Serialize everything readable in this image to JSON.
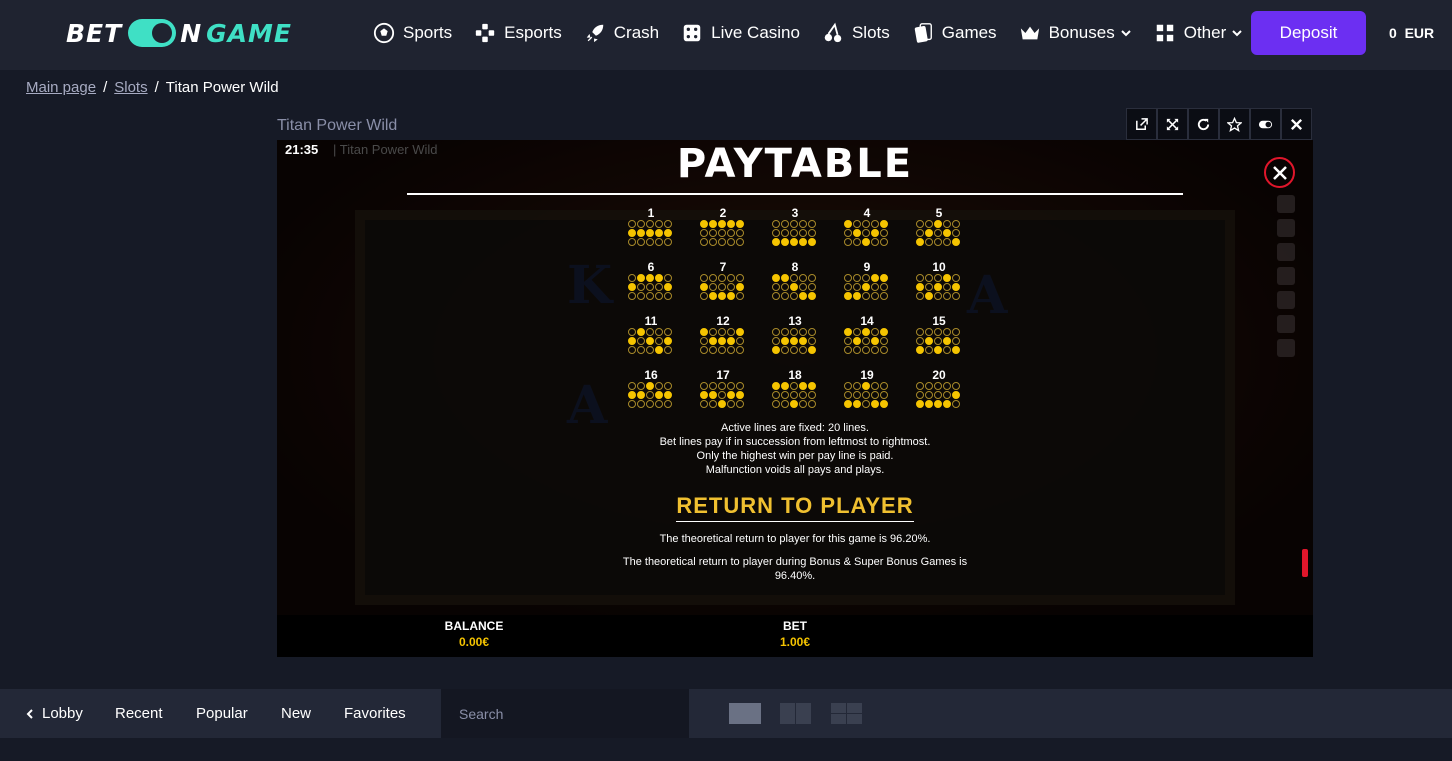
{
  "brand": {
    "part1": "BET",
    "part2": "N",
    "part3": "GAME"
  },
  "nav": [
    {
      "label": "Sports",
      "icon": "soccer-ball-icon"
    },
    {
      "label": "Esports",
      "icon": "gamepad-icon"
    },
    {
      "label": "Crash",
      "icon": "rocket-icon"
    },
    {
      "label": "Live Casino",
      "icon": "dice-icon"
    },
    {
      "label": "Slots",
      "icon": "cherries-icon"
    },
    {
      "label": "Games",
      "icon": "cards-icon"
    },
    {
      "label": "Bonuses",
      "icon": "crown-icon"
    },
    {
      "label": "Other",
      "icon": "grid-icon"
    }
  ],
  "header": {
    "deposit_label": "Deposit",
    "balance": "0",
    "currency": "EUR"
  },
  "breadcrumb": {
    "home": "Main page",
    "slots": "Slots",
    "current": "Titan Power Wild"
  },
  "game": {
    "title": "Titan Power Wild",
    "clock": "21:35",
    "clock_title": "| Titan Power Wild",
    "paytable_title": "PAYTABLE",
    "info_lines": [
      "Active lines are fixed: 20 lines.",
      "Bet lines pay if in succession from leftmost to rightmost.",
      "Only the highest win per pay line is paid.",
      "Malfunction voids all pays and plays."
    ],
    "rtp_title": "RETURN TO PLAYER",
    "rtp_text1": "The theoretical return to player for this game is 96.20%.",
    "rtp_text2": "The theoretical return to player during Bonus & Super Bonus Games is 96.40%.",
    "balance_label": "BALANCE",
    "balance_value": "0.00€",
    "bet_label": "BET",
    "bet_value": "1.00€",
    "counter": "0"
  },
  "paylines": [
    {
      "n": "1",
      "rows": [
        1,
        1,
        1,
        1,
        1
      ]
    },
    {
      "n": "2",
      "rows": [
        0,
        0,
        0,
        0,
        0
      ]
    },
    {
      "n": "3",
      "rows": [
        2,
        2,
        2,
        2,
        2
      ]
    },
    {
      "n": "4",
      "rows": [
        0,
        1,
        2,
        1,
        0
      ]
    },
    {
      "n": "5",
      "rows": [
        2,
        1,
        0,
        1,
        2
      ]
    },
    {
      "n": "6",
      "rows": [
        1,
        0,
        0,
        0,
        1
      ]
    },
    {
      "n": "7",
      "rows": [
        1,
        2,
        2,
        2,
        1
      ]
    },
    {
      "n": "8",
      "rows": [
        0,
        0,
        1,
        2,
        2
      ]
    },
    {
      "n": "9",
      "rows": [
        2,
        2,
        1,
        0,
        0
      ]
    },
    {
      "n": "10",
      "rows": [
        1,
        2,
        1,
        0,
        1
      ]
    },
    {
      "n": "11",
      "rows": [
        1,
        0,
        1,
        2,
        1
      ]
    },
    {
      "n": "12",
      "rows": [
        0,
        1,
        1,
        1,
        0
      ]
    },
    {
      "n": "13",
      "rows": [
        2,
        1,
        1,
        1,
        2
      ]
    },
    {
      "n": "14",
      "rows": [
        0,
        1,
        0,
        1,
        0
      ]
    },
    {
      "n": "15",
      "rows": [
        2,
        1,
        2,
        1,
        2
      ]
    },
    {
      "n": "16",
      "rows": [
        1,
        1,
        0,
        1,
        1
      ]
    },
    {
      "n": "17",
      "rows": [
        1,
        1,
        2,
        1,
        1
      ]
    },
    {
      "n": "18",
      "rows": [
        0,
        0,
        2,
        0,
        0
      ]
    },
    {
      "n": "19",
      "rows": [
        2,
        2,
        0,
        2,
        2
      ]
    },
    {
      "n": "20",
      "rows": [
        2,
        2,
        2,
        2,
        1
      ]
    }
  ],
  "bottombar": {
    "lobby": "Lobby",
    "recent": "Recent",
    "popular": "Popular",
    "new": "New",
    "favorites": "Favorites",
    "search_placeholder": "Search"
  }
}
